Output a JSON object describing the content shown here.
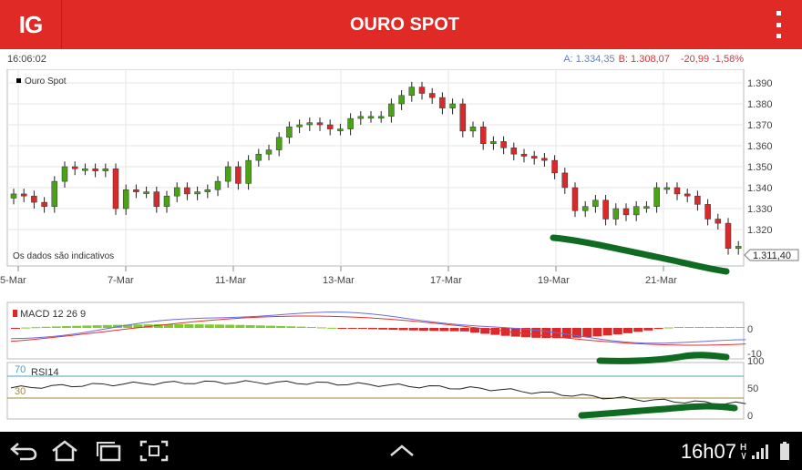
{
  "header": {
    "logo": "IG",
    "title": "OURO SPOT"
  },
  "quote": {
    "time": "16:06:02",
    "ask": "A: 1.334,35",
    "bid": "B: 1.308,07",
    "change": "-20,99  -1,58%"
  },
  "chart": {
    "legend": "Ouro Spot",
    "note": "Os dados são indicativos",
    "price_axis": [
      "1.390",
      "1.380",
      "1.370",
      "1.360",
      "1.350",
      "1.340",
      "1.330",
      "1.320"
    ],
    "current_price": "1.311,40",
    "date_labels": [
      "5-Mar",
      "7-Mar",
      "11-Mar",
      "13-Mar",
      "17-Mar",
      "19-Mar",
      "21-Mar"
    ],
    "macd_label": "MACD 12 26 9",
    "macd_axis": [
      "0",
      "-10"
    ],
    "rsi_label": "RSI14",
    "rsi_levels": [
      "70",
      "30"
    ],
    "rsi_axis": [
      "100",
      "50",
      "0"
    ],
    "colors": {
      "up": "#4aa216",
      "down": "#d9292a",
      "macd_line": "#6b6ce0",
      "signal_line": "#e53030",
      "rsi_level_line": "#4aa0c0",
      "rsi_low_line": "#a08a3a",
      "marker": "#0f6b22"
    }
  },
  "navbar": {
    "clock": "16h07"
  }
}
